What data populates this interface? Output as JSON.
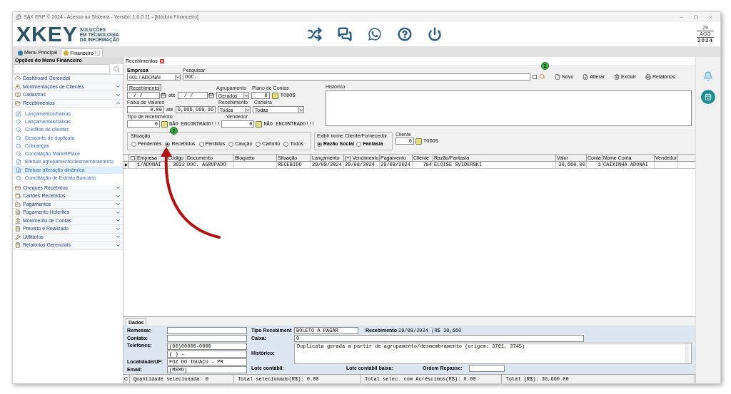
{
  "window": {
    "title": "SAX ERP © 2024 - Acesso ao Sistema - Versão: 1.6.0.11 - [Módulo Financeiro]"
  },
  "header": {
    "logo": "XKEY",
    "tagline": [
      "SOLUÇÕES",
      "EM TECNOLOGIA",
      "DA INFORMAÇÃO"
    ],
    "date": {
      "day": "29",
      "month": "AGO",
      "year": "2024"
    }
  },
  "module_tabs": [
    {
      "label": "Menu Principal",
      "selected": false
    },
    {
      "label": "Financeiro",
      "selected": true
    }
  ],
  "sidebar": {
    "title": "Opções do Menu Financeiro",
    "items": [
      {
        "kind": "link",
        "label": "Dashboard Gerencial"
      },
      {
        "kind": "group",
        "label": "Movimentações de Clientes",
        "expanded": false
      },
      {
        "kind": "group",
        "label": "Cadastros",
        "expanded": false
      },
      {
        "kind": "group",
        "label": "Recebimentos",
        "expanded": true,
        "children": [
          {
            "label": "Lançamentos/baixas",
            "selected": false
          },
          {
            "label": "Lançamentos/baixas",
            "selected": false
          },
          {
            "label": "Créditos de clientes",
            "selected": false
          },
          {
            "label": "Desconto de duplicata",
            "selected": false
          },
          {
            "label": "Cobranças",
            "selected": false
          },
          {
            "label": "Conciliação MarketPlace",
            "selected": false
          },
          {
            "label": "Efetuar agrupamento/desmembramento",
            "selected": false
          },
          {
            "label": "Efetuar alteração dinâmica",
            "selected": true
          },
          {
            "label": "Conciliação de Extrato Bancário",
            "selected": false
          }
        ]
      },
      {
        "kind": "group",
        "label": "Cheques Recebidos",
        "expanded": false
      },
      {
        "kind": "group",
        "label": "Cartões Recebidos",
        "expanded": false
      },
      {
        "kind": "group",
        "label": "Pagamentos",
        "expanded": false
      },
      {
        "kind": "group",
        "label": "Pagamento Holerites",
        "expanded": false
      },
      {
        "kind": "group",
        "label": "Movimento de Contas",
        "expanded": false
      },
      {
        "kind": "group",
        "label": "Previsto e Realizado",
        "expanded": false
      },
      {
        "kind": "group",
        "label": "Utilitários",
        "expanded": false
      },
      {
        "kind": "group",
        "label": "Relatórios Gerenciais",
        "expanded": false
      }
    ]
  },
  "document_tab": {
    "label": "Recebimentos"
  },
  "form": {
    "empresa": {
      "label": "Empresa",
      "value": "001 / ADONAI"
    },
    "pesquisar": {
      "label": "Pesquisar",
      "value": "DOC."
    },
    "date_filter": {
      "value": "Recebimento",
      "from": "/ /",
      "between": "até",
      "to": "/ /"
    },
    "agrupamento": {
      "label": "Agrupamento",
      "value": "Gerados"
    },
    "plano_de_contas": {
      "label": "Plano de Contas",
      "value": "0",
      "result": "TODOS"
    },
    "historico": {
      "label": "Histórico"
    },
    "faixa_de_valores": {
      "label": "Faixa de Valores",
      "from": "0.00",
      "between": "até",
      "to": "9,999,999.99"
    },
    "recebimento": {
      "label": "Recebimento",
      "value": "Todos"
    },
    "carteira": {
      "label": "Carteira",
      "value": "Todas"
    },
    "tipo_de_recebimento": {
      "label": "Tipo de recebimento",
      "value": "0",
      "result": "NÃO ENCONTRADO!!!"
    },
    "vendedor": {
      "label": "Vendedor",
      "value": "0",
      "result": "NÃO ENCONTRADO!!!"
    },
    "situacao": {
      "title": "Situação",
      "options": [
        {
          "label": "Pendentes",
          "selected": false
        },
        {
          "label": "Recebidos",
          "selected": true
        },
        {
          "label": "Perdidos",
          "selected": false
        },
        {
          "label": "Caução",
          "selected": false
        },
        {
          "label": "Cartório",
          "selected": false
        },
        {
          "label": "Todos",
          "selected": false
        }
      ]
    },
    "exibir_nome": {
      "title": "Exibir nome Cliente/Fornecedor",
      "options": [
        {
          "label": "Razão Social",
          "selected": true
        },
        {
          "label": "Fantasia",
          "selected": false
        }
      ]
    },
    "cliente": {
      "label": "Cliente",
      "value": "0",
      "result": "TODOS"
    }
  },
  "toolbar": {
    "checked": false,
    "buttons": [
      "Novo",
      "Alterar",
      "Excluir",
      "Relatórios"
    ]
  },
  "grid": {
    "header_checked": false,
    "columns": [
      "Empresa",
      "Código",
      "Documento",
      "Bloqueto",
      "Situação",
      "Lançamento",
      "(+) Vencimento",
      "Pagamento",
      "Cliente",
      "Razão/Fantasia",
      "Valor",
      "Conta",
      "Nome Conta",
      "Vendedor"
    ],
    "rows": [
      {
        "selected": true,
        "cells": [
          "1/ADONAI",
          "3932",
          "DOC. AGRUPADO",
          null,
          "RECEBIDO",
          "29/08/2024",
          "29/08/2024",
          "29/08/2024",
          "784",
          "ELOISE SVIDERSKI",
          "30,660.00",
          "1",
          "CAIXINHA ADONAI",
          null
        ]
      }
    ]
  },
  "details": {
    "tab": "Dados",
    "remessa": {
      "label": "Remessa:"
    },
    "contato": {
      "label": "Contato:"
    },
    "telefones": {
      "label": "Telefones:",
      "values": [
        "(00)00000-0000",
        "(  )     -"
      ]
    },
    "localidade": {
      "label": "Localidade/UF:",
      "value": "FOZ DO IGUAÇU - PR"
    },
    "email": {
      "label": "Email:",
      "value": "(MEMO)"
    },
    "tipo_recebimento": {
      "label": "Tipo Recebiment",
      "value": "BOLETO A PAGAR"
    },
    "recebimento": {
      "label": "Recebimento",
      "value": "29/08/2024 (R$ 30,660"
    },
    "caixa": {
      "label": "Caixa:",
      "value": "0"
    },
    "historico": {
      "label": "Histórico:",
      "value": "Duplicata gerada a partir de agrupamento/desmembramento  (origem:  3761, 3745)"
    },
    "lote_contabil": {
      "label": "Lote contábil:"
    },
    "lote_contabil_baixa": {
      "label": "Lote contábil baixa:"
    },
    "ordem_repasse": {
      "label": "Ordem Repasse:"
    }
  },
  "status_bar": {
    "corner": "C",
    "items": [
      "Quantidade selecionada: 0",
      "Total selecionado(R$): 0.00",
      "Total selec. com Acréscimos(R$): 0.00",
      "Total (R$): 30,660.00"
    ]
  },
  "annotations": {
    "badges": [
      "1",
      "2"
    ]
  }
}
